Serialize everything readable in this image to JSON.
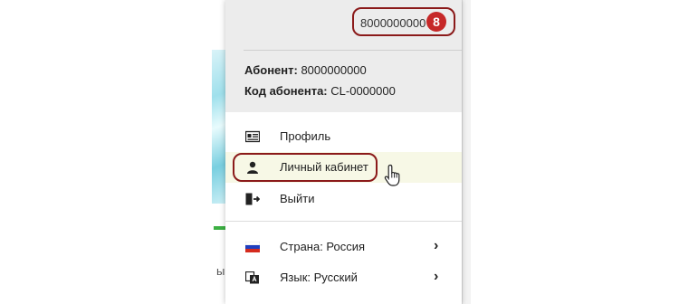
{
  "header": {
    "phone_number": "8000000000",
    "step_badge": "8",
    "subscriber_label": "Абонент:",
    "subscriber_value": "8000000000",
    "code_label": "Код абонента:",
    "code_value": "CL-0000000"
  },
  "menu": {
    "profile": "Профиль",
    "cabinet": "Личный кабинет",
    "logout": "Выйти",
    "country": "Страна: Россия",
    "language": "Язык: Русский"
  },
  "background": {
    "partial_text": "ый з"
  },
  "colors": {
    "annotation_red": "#8b1a1a",
    "badge_red": "#c62828",
    "hover_bg": "#f7f8e6"
  }
}
